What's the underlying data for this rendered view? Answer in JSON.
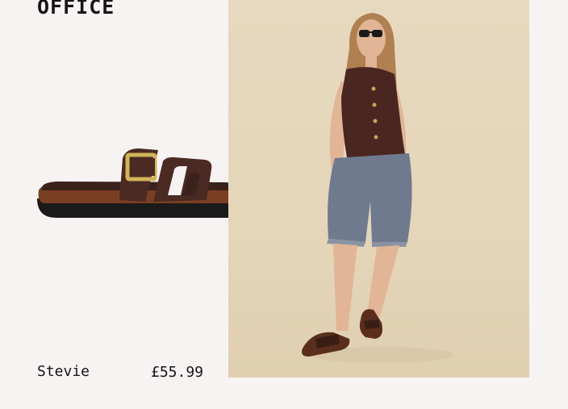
{
  "brand": {
    "name": "OFFICE"
  },
  "product": {
    "name": "Stevie",
    "price": "£55.99",
    "image": "sandal-product-image",
    "lifestyle_image": "model-wearing-sandals-photo"
  },
  "colors": {
    "background": "#f8f3f3",
    "text": "#151515",
    "photo_background": "#e5d6ba",
    "sandal_brown": "#4a2a22",
    "sole_brown": "#7a3f22",
    "buckle_gold": "#d2b45a"
  }
}
